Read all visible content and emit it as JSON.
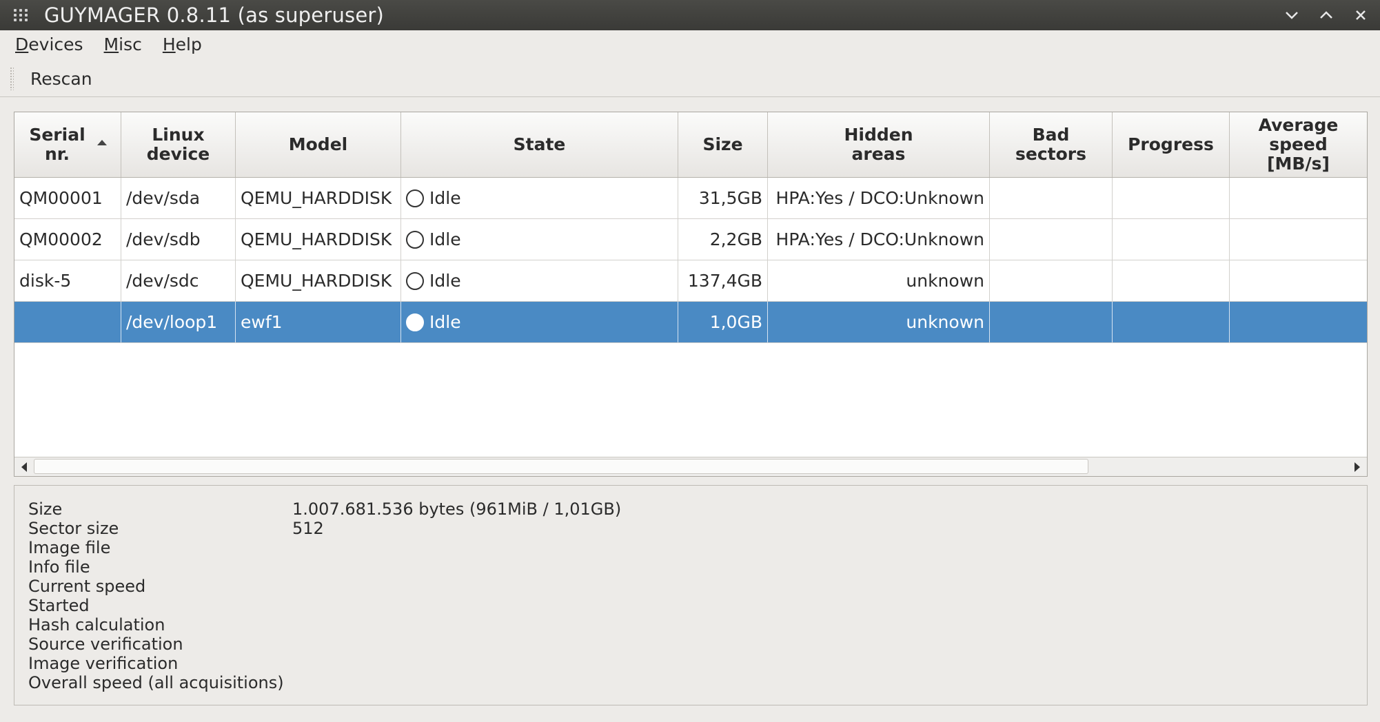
{
  "window": {
    "title": "GUYMAGER 0.8.11 (as superuser)",
    "buttons": {
      "minimize": "⌄",
      "maximize": "⌃",
      "close": "×"
    }
  },
  "menu": {
    "items": [
      {
        "label_first": "D",
        "label_rest": "evices"
      },
      {
        "label_first": "M",
        "label_rest": "isc"
      },
      {
        "label_first": "H",
        "label_rest": "elp"
      }
    ]
  },
  "toolbar": {
    "rescan_label": "Rescan"
  },
  "table": {
    "columns": [
      {
        "label": "Serial\nnr.",
        "sorted": "ascending"
      },
      {
        "label": "Linux\ndevice"
      },
      {
        "label": "Model"
      },
      {
        "label": "State"
      },
      {
        "label": "Size"
      },
      {
        "label": "Hidden\nareas"
      },
      {
        "label": "Bad\nsectors"
      },
      {
        "label": "Progress"
      },
      {
        "label": "Average\nspeed\n[MB/s]"
      }
    ],
    "rows": [
      {
        "serial": "QM00001",
        "device": "/dev/sda",
        "model": "QEMU_HARDDISK",
        "state": "Idle",
        "size": "31,5GB",
        "hidden": "HPA:Yes / DCO:Unknown",
        "bad": "",
        "progress": "",
        "speed": "",
        "selected": false
      },
      {
        "serial": "QM00002",
        "device": "/dev/sdb",
        "model": "QEMU_HARDDISK",
        "state": "Idle",
        "size": "2,2GB",
        "hidden": "HPA:Yes / DCO:Unknown",
        "bad": "",
        "progress": "",
        "speed": "",
        "selected": false
      },
      {
        "serial": "disk-5",
        "device": "/dev/sdc",
        "model": "QEMU_HARDDISK",
        "state": "Idle",
        "size": "137,4GB",
        "hidden": "unknown",
        "bad": "",
        "progress": "",
        "speed": "",
        "selected": false
      },
      {
        "serial": "",
        "device": "/dev/loop1",
        "model": "ewf1",
        "state": "Idle",
        "size": "1,0GB",
        "hidden": "unknown",
        "bad": "",
        "progress": "",
        "speed": "",
        "selected": true
      }
    ]
  },
  "info": {
    "rows": [
      {
        "label": "Size",
        "value": "1.007.681.536 bytes (961MiB / 1,01GB)"
      },
      {
        "label": "Sector size",
        "value": "512"
      },
      {
        "label": "Image file",
        "value": ""
      },
      {
        "label": "Info file",
        "value": ""
      },
      {
        "label": "Current speed",
        "value": ""
      },
      {
        "label": "Started",
        "value": ""
      },
      {
        "label": "Hash calculation",
        "value": ""
      },
      {
        "label": "Source verification",
        "value": ""
      },
      {
        "label": "Image verification",
        "value": ""
      },
      {
        "label": "Overall speed (all acquisitions)",
        "value": ""
      }
    ]
  },
  "colors": {
    "selection": "#4a8ac4",
    "titlebar": "#3f3f3c",
    "window_bg": "#edebe8"
  }
}
